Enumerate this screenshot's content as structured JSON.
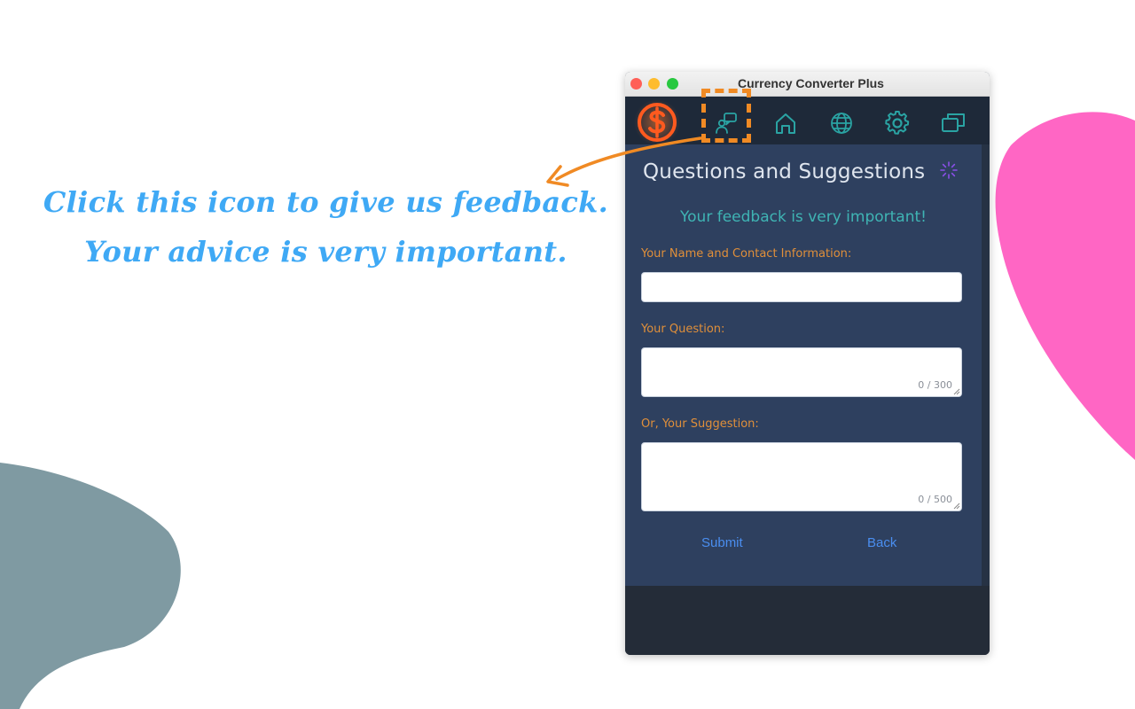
{
  "promo": {
    "line1": "Click this icon to give us feedback.",
    "line2": "Your advice is very important."
  },
  "window": {
    "title": "Currency Converter Plus"
  },
  "toolbar": {
    "icons": [
      "dollar-logo-icon",
      "feedback-chat-icon",
      "home-icon",
      "globe-icon",
      "gear-icon",
      "windows-icon"
    ]
  },
  "form": {
    "heading": "Questions and Suggestions",
    "subheading": "Your feedback is very important!",
    "name_label": "Your Name and Contact Information:",
    "name_value": "",
    "question_label": "Your Question:",
    "question_value": "",
    "question_counter": "0 / 300",
    "suggestion_label": "Or, Your Suggestion:",
    "suggestion_value": "",
    "suggestion_counter": "0 / 500",
    "submit_label": "Submit",
    "back_label": "Back"
  },
  "colors": {
    "accent_orange": "#f08a24",
    "promo_blue": "#3fa9f5",
    "teal": "#3fb4b4",
    "panel": "#2e405f",
    "pink_blob": "#ff66c4",
    "gray_blob": "#7f9aa2"
  }
}
